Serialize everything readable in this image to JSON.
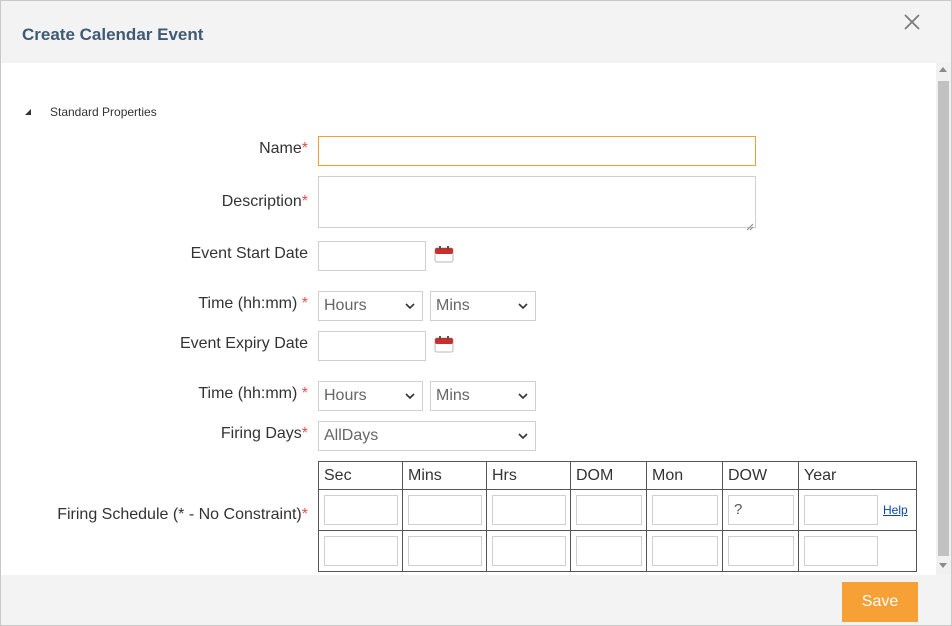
{
  "dialog": {
    "title": "Create Calendar Event",
    "close_icon": "close-icon"
  },
  "section": {
    "title": "Standard Properties",
    "toggle_icon": "collapse-triangle-icon"
  },
  "fields": {
    "name": {
      "label": "Name",
      "required": "*",
      "value": ""
    },
    "description": {
      "label": "Description",
      "required": "*",
      "value": ""
    },
    "event_start_date": {
      "label": "Event Start Date",
      "value": "",
      "icon": "calendar-icon"
    },
    "start_time": {
      "label": "Time  (hh:mm)",
      "required": "*",
      "hours": "Hours",
      "mins": "Mins"
    },
    "event_expiry_date": {
      "label": "Event Expiry Date",
      "value": "",
      "icon": "calendar-icon"
    },
    "expiry_time": {
      "label": "Time  (hh:mm)",
      "required": "*",
      "hours": "Hours",
      "mins": "Mins"
    },
    "firing_days": {
      "label": "Firing Days",
      "required": "*",
      "value": "AllDays"
    },
    "firing_schedule": {
      "label": "Firing Schedule (* - No Constraint)",
      "required": "*"
    }
  },
  "schedule": {
    "columns": [
      "Sec",
      "Mins",
      "Hrs",
      "DOM",
      "Mon",
      "DOW",
      "Year"
    ],
    "row1": [
      "",
      "",
      "",
      "",
      "",
      "?",
      ""
    ],
    "row2": [
      "",
      "",
      "",
      "",
      "",
      "",
      ""
    ],
    "help_label": "Help"
  },
  "footer": {
    "save_label": "Save"
  },
  "colors": {
    "accent": "#f7a035",
    "title": "#3f5a74",
    "required": "#d9534f",
    "link": "#0645ad"
  }
}
